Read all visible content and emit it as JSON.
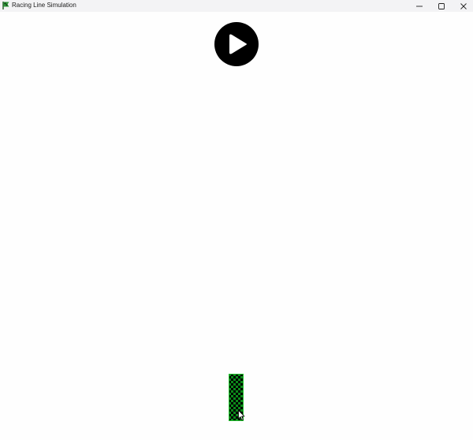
{
  "window": {
    "title": "Racing Line Simulation",
    "app_icon": "race-flag-icon",
    "controls": {
      "minimize_icon": "minimize-icon",
      "maximize_icon": "maximize-icon",
      "close_icon": "close-icon"
    }
  },
  "canvas": {
    "play_button_icon": "play-icon",
    "finish_line": "checkered-finish-line",
    "colors": {
      "background": "#fefefe",
      "play_button": "#000000",
      "finish_green": "#0b8a1a",
      "finish_black": "#000000"
    }
  }
}
